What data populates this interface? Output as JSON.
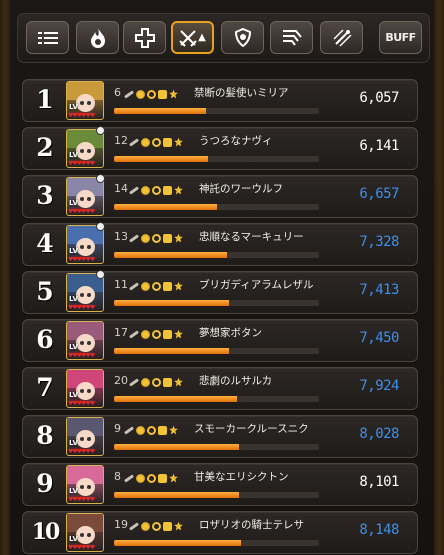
{
  "toolbar": {
    "buttons": [
      {
        "icon": "list-icon"
      },
      {
        "icon": "flame-icon"
      },
      {
        "icon": "cross-icon"
      },
      {
        "icon": "crossed-swords-icon",
        "sort": "▲",
        "active": true
      },
      {
        "icon": "shield-icon"
      },
      {
        "icon": "wind-icon"
      },
      {
        "icon": "sparkle-icon"
      },
      {
        "label": "BUFF"
      }
    ]
  },
  "colors": {
    "accent": "#e8a11e",
    "score_white": "#ffffff",
    "score_blue": "#3d8fe6",
    "bar": "#f08a1c"
  },
  "rows": [
    {
      "rank": "1",
      "level": "6",
      "name": "禁断の髪使いミリア",
      "score": "6,057",
      "score_color": "#ffffff",
      "progress": 0.45,
      "hair": "#c99a3a",
      "skull": false
    },
    {
      "rank": "2",
      "level": "12",
      "name": "うつろなナヴィ",
      "score": "6,141",
      "score_color": "#ffffff",
      "progress": 0.46,
      "hair": "#6c8b3a",
      "skull": true
    },
    {
      "rank": "3",
      "level": "14",
      "name": "神託のワーウルフ",
      "score": "6,657",
      "score_color": "#3d8fe6",
      "progress": 0.5,
      "hair": "#8a86a8",
      "skull": true
    },
    {
      "rank": "4",
      "level": "13",
      "name": "忠順なるマーキュリー",
      "score": "7,328",
      "score_color": "#3d8fe6",
      "progress": 0.55,
      "hair": "#4a6fae",
      "skull": true
    },
    {
      "rank": "5",
      "level": "11",
      "name": "ブリガディアラムレザル",
      "score": "7,413",
      "score_color": "#3d8fe6",
      "progress": 0.56,
      "hair": "#3a5f8e",
      "skull": true
    },
    {
      "rank": "6",
      "level": "17",
      "name": "夢想家ボタン",
      "score": "7,450",
      "score_color": "#3d8fe6",
      "progress": 0.56,
      "hair": "#9a5a7a",
      "skull": false
    },
    {
      "rank": "7",
      "level": "20",
      "name": "悲劇のルサルカ",
      "score": "7,924",
      "score_color": "#3d8fe6",
      "progress": 0.6,
      "hair": "#d0457a",
      "skull": false
    },
    {
      "rank": "8",
      "level": "9",
      "name": "スモーカークルースニク",
      "score": "8,028",
      "score_color": "#3d8fe6",
      "progress": 0.61,
      "hair": "#5a5870",
      "skull": false
    },
    {
      "rank": "9",
      "level": "8",
      "name": "甘美なエリシクトン",
      "score": "8,101",
      "score_color": "#ffffff",
      "progress": 0.61,
      "hair": "#d86a9a",
      "skull": false
    },
    {
      "rank": "10",
      "level": "19",
      "name": "ロザリオの騎士テレサ",
      "score": "8,148",
      "score_color": "#3d8fe6",
      "progress": 0.62,
      "hair": "#7a4a3a",
      "skull": false
    }
  ]
}
